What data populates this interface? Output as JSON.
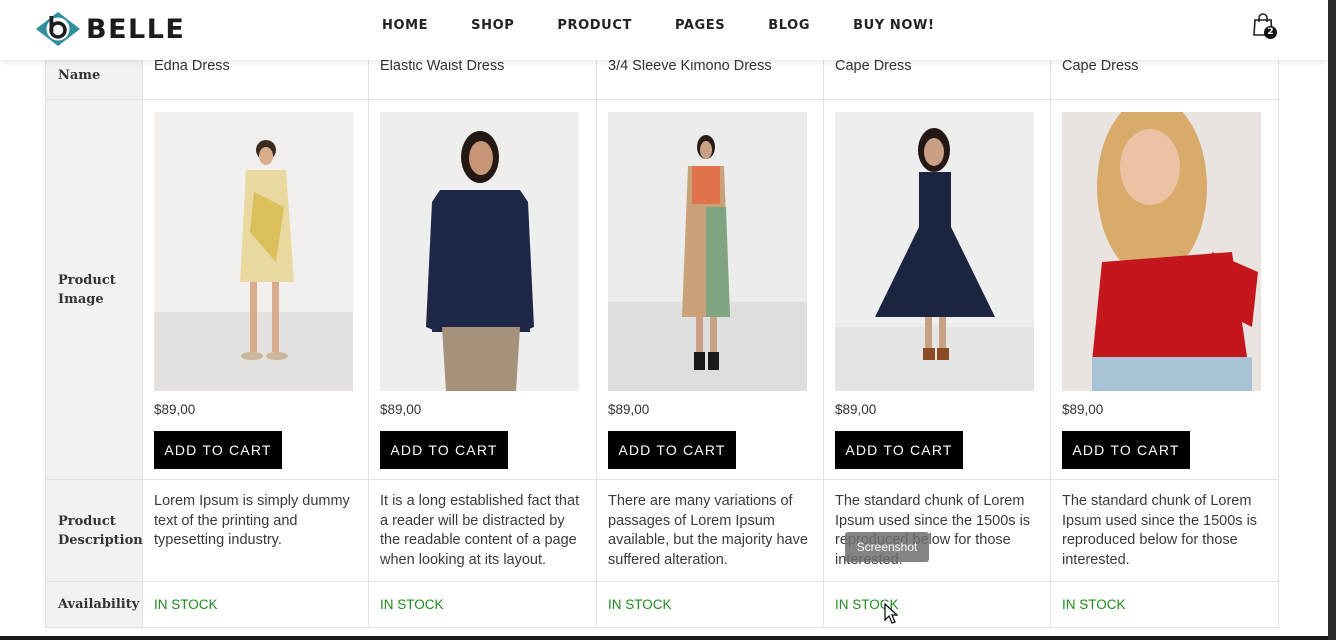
{
  "brand": {
    "name": "BELLE",
    "accent": "#2f8f9d"
  },
  "nav": [
    "HOME",
    "SHOP",
    "PRODUCT",
    "PAGES",
    "BLOG",
    "BUY NOW!"
  ],
  "cart": {
    "icon": "shopping-bag-icon",
    "count": "2"
  },
  "row_labels": {
    "name": "Product Name",
    "image": "Product Image",
    "description": "Product Description",
    "availability": "Availability"
  },
  "products": [
    {
      "name": "Edna Dress",
      "price": "$89,00",
      "button": "ADD TO CART",
      "description": "Lorem Ipsum is simply dummy text of the printing and typesetting industry.",
      "availability": "IN STOCK",
      "photo_bg": "#f1f0ee",
      "dress_color": "#e9d9a0"
    },
    {
      "name": "Elastic Waist Dress",
      "price": "$89,00",
      "button": "ADD TO CART",
      "description": "It is a long established fact that a reader will be distracted by the readable content of a page when looking at its layout.",
      "availability": "IN STOCK",
      "photo_bg": "#eeeeee",
      "dress_color": "#1e2747"
    },
    {
      "name": "3/4 Sleeve Kimono Dress",
      "price": "$89,00",
      "button": "ADD TO CART",
      "description": "There are many variations of passages of Lorem Ipsum available, but the majority have suffered alteration.",
      "availability": "IN STOCK",
      "photo_bg": "#ececec",
      "dress_color": "#c9a27a"
    },
    {
      "name": "Cape Dress",
      "price": "$89,00",
      "button": "ADD TO CART",
      "description": "The standard chunk of Lorem Ipsum used since the 1500s is reproduced below for those interested.",
      "availability": "IN STOCK",
      "photo_bg": "#eeeeee",
      "dress_color": "#1b2540"
    },
    {
      "name": "Cape Dress",
      "price": "$89,00",
      "button": "ADD TO CART",
      "description": "The standard chunk of Lorem Ipsum used since the 1500s is reproduced below for those interested.",
      "availability": "IN STOCK",
      "photo_bg": "#e9e4df",
      "dress_color": "#c4161c"
    }
  ],
  "tooltip": "Screenshot",
  "colors": {
    "stock_green": "#1f8b1f",
    "button_bg": "#000000"
  }
}
